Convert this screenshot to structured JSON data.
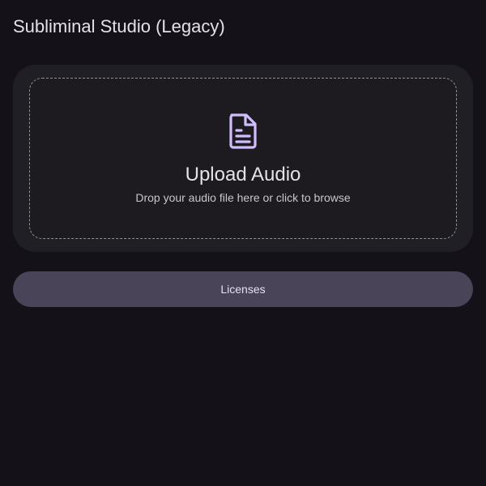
{
  "app": {
    "title": "Subliminal Studio (Legacy)"
  },
  "upload": {
    "icon": "file-document-icon",
    "heading": "Upload Audio",
    "subtitle": "Drop your audio file here or click to browse"
  },
  "actions": {
    "licenses_label": "Licenses"
  },
  "colors": {
    "background": "#141218",
    "card": "#211f26",
    "accent": "#d0bcff",
    "button": "#4a4458"
  }
}
